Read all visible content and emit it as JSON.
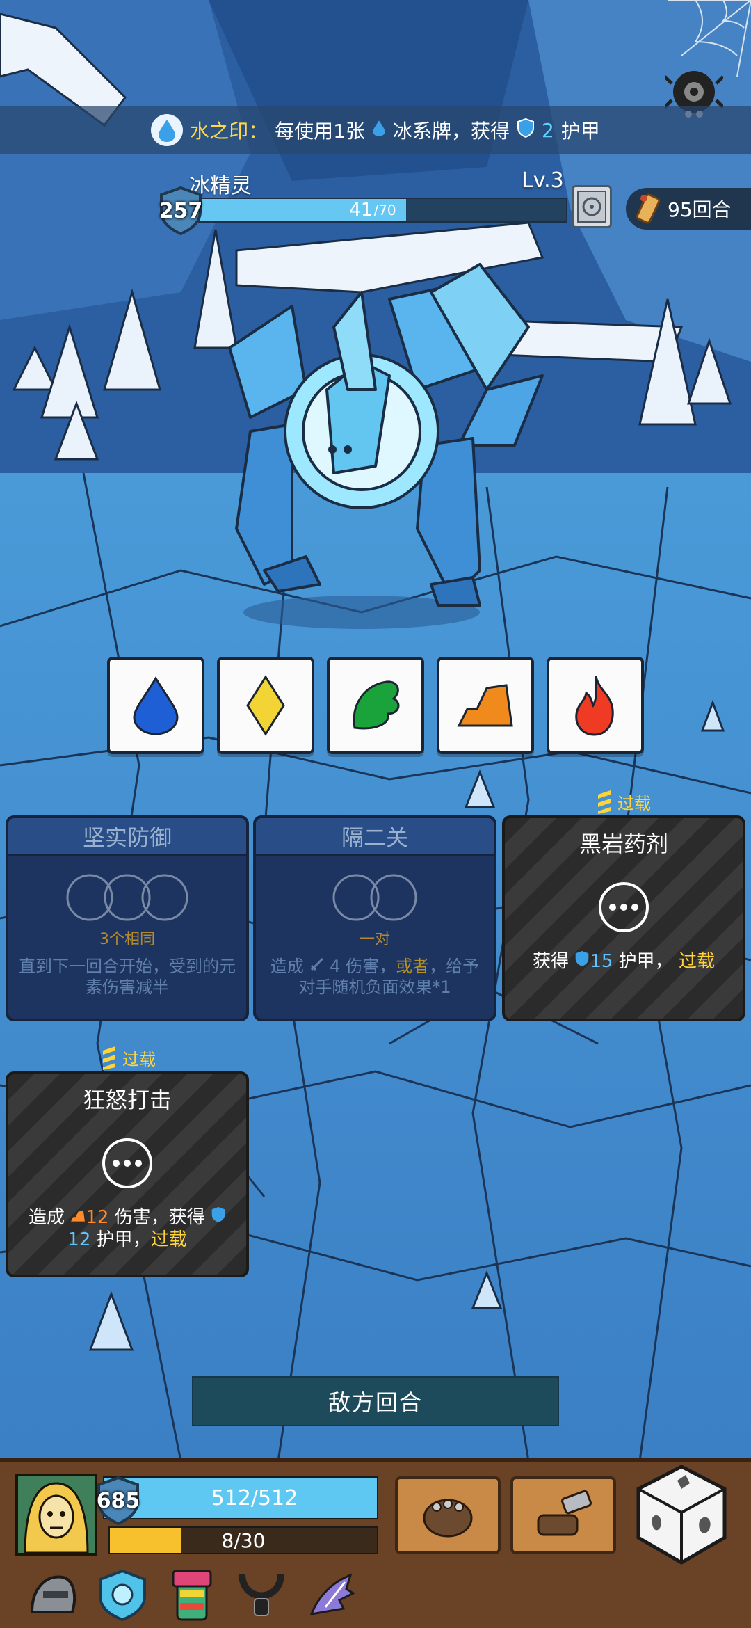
{
  "seal_bar": {
    "icon": "water-drop-icon",
    "title": "水之印：",
    "text_a": "每使用1张",
    "text_b": "冰系牌，获得",
    "armor_value": "2",
    "text_c": "护甲"
  },
  "enemy": {
    "name": "冰精灵",
    "level": "Lv.3",
    "shield": "257",
    "hp_current": "41",
    "hp_max": "/70",
    "hp_fraction": 0.586
  },
  "turns": {
    "label": "95回合",
    "icon": "scroll-icon"
  },
  "elements": [
    {
      "name": "water",
      "icon": "water-drop-icon",
      "color": "#1e5fd6"
    },
    {
      "name": "lightning",
      "icon": "yellow-diamond-icon",
      "color": "#f2d534"
    },
    {
      "name": "wood",
      "icon": "green-leaf-icon",
      "color": "#1aa33a"
    },
    {
      "name": "earth",
      "icon": "orange-rock-icon",
      "color": "#f08a1c"
    },
    {
      "name": "fire",
      "icon": "fire-icon",
      "color": "#ef3b24"
    }
  ],
  "cards": {
    "solid_defense": {
      "title": "坚实防御",
      "requirement": "3个相同",
      "desc": "直到下一回合开始，受到的元素伤害减半"
    },
    "separate": {
      "title": "隔二关",
      "requirement": "一对",
      "desc_a": "造成",
      "damage": "4",
      "desc_b": "伤害，",
      "or": "或者",
      "desc_c": "，给予对手随机负面效果*1"
    },
    "black_rock_potion": {
      "overload_tag": "过载",
      "title": "黑岩药剂",
      "desc_a": "获得",
      "armor": "15",
      "desc_b": "护甲，",
      "overload": "过载"
    },
    "rage_strike": {
      "overload_tag": "过载",
      "title": "狂怒打击",
      "desc_a": "造成",
      "damage": "12",
      "desc_b": "伤害，获得",
      "armor": "12",
      "desc_c": "护甲，",
      "overload": "过载"
    }
  },
  "enemy_turn_button": "敌方回合",
  "player": {
    "shield": "685",
    "hp_text": "512/512",
    "hp_fraction": 1.0,
    "energy_text": "8/30",
    "energy_fraction": 0.267
  },
  "skills": [
    "fist-icon",
    "hammer-icon"
  ],
  "equipment": [
    "helmet-icon",
    "ice-shield-icon",
    "totem-icon",
    "necklace-icon",
    "claw-icon"
  ]
}
